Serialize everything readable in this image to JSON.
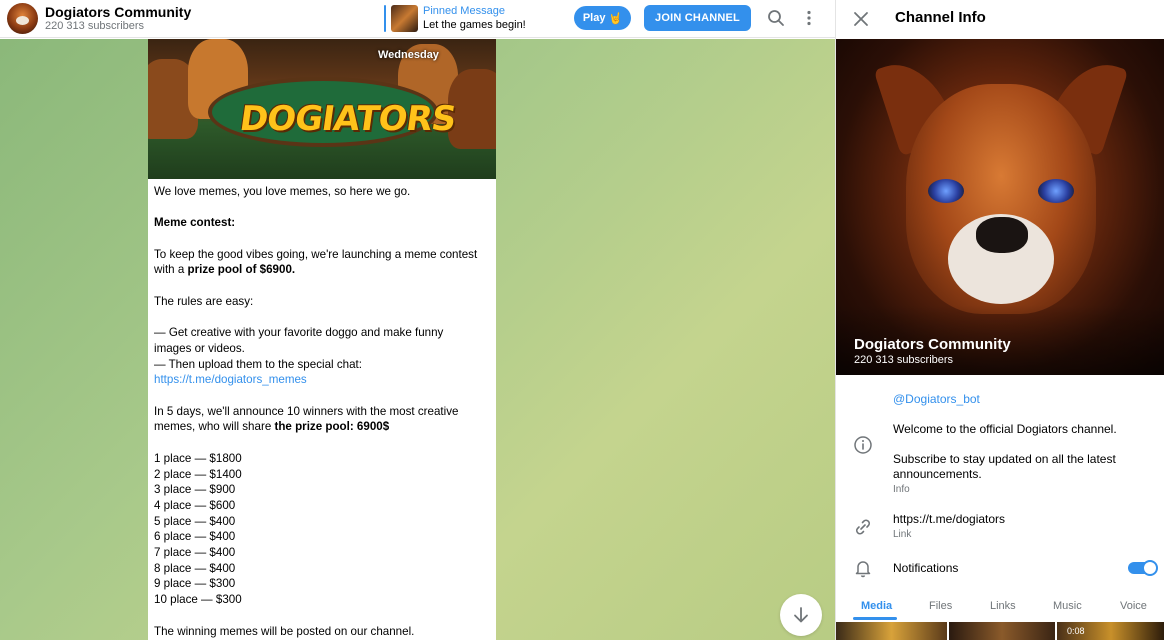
{
  "header": {
    "channel_title": "Dogiators Community",
    "channel_subtitle": "220 313 subscribers",
    "pinned_title": "Pinned Message",
    "pinned_text": "Let the games begin!",
    "play_label": "Play",
    "play_emoji": "🤘",
    "join_label": "JOIN CHANNEL",
    "icons": [
      "search-icon",
      "more-vertical-icon"
    ]
  },
  "post": {
    "image_day_label": "Wednesday",
    "image_logo_text": "DOGIATORS",
    "lines": [
      "We love memes, you love memes, so here we go.",
      "",
      "",
      "",
      "To keep the good vibes going, we're launching a meme contest",
      "",
      "",
      "The rules are easy:",
      "",
      "— Get creative with your favorite doggo and make funny",
      "images or videos.",
      "— Then upload them to the special chat:",
      "",
      "",
      "In 5 days, we'll announce 10 winners with the most creative",
      "",
      "",
      "1 place — $1800",
      "2 place — $1400",
      "3 place — $900",
      "4 place — $600",
      "5 place — $400",
      "6 place — $400",
      "7 place — $400",
      "8 place — $400",
      "9 place — $300",
      "10 place — $300",
      "",
      "The winning memes will be posted on our channel."
    ],
    "contest_heading": "Meme contest:",
    "prize_prefix": "with a ",
    "prize_bold": "prize pool of $6900.",
    "chat_link": "https://t.me/dogiators_memes",
    "winners_prefix": "memes, who will share ",
    "winners_bold": "the prize pool: 6900$"
  },
  "panel": {
    "title": "Channel Info",
    "hero_title": "Dogiators Community",
    "hero_subtitle": "220 313 subscribers",
    "bot_handle": "@Dogiators_bot",
    "description_1": "Welcome to the official Dogiators channel.",
    "description_2": "Subscribe to stay updated on all the latest announcements.",
    "description_label": "Info",
    "link_value": "https://t.me/dogiators",
    "link_label": "Link",
    "notifications_label": "Notifications",
    "notifications_on": true,
    "tabs": [
      "Media",
      "Files",
      "Links",
      "Music",
      "Voice"
    ],
    "media_duration": "0:08"
  },
  "colors": {
    "accent": "#3390ec",
    "muted": "#707579",
    "chat_bg": "#a8c98a"
  }
}
